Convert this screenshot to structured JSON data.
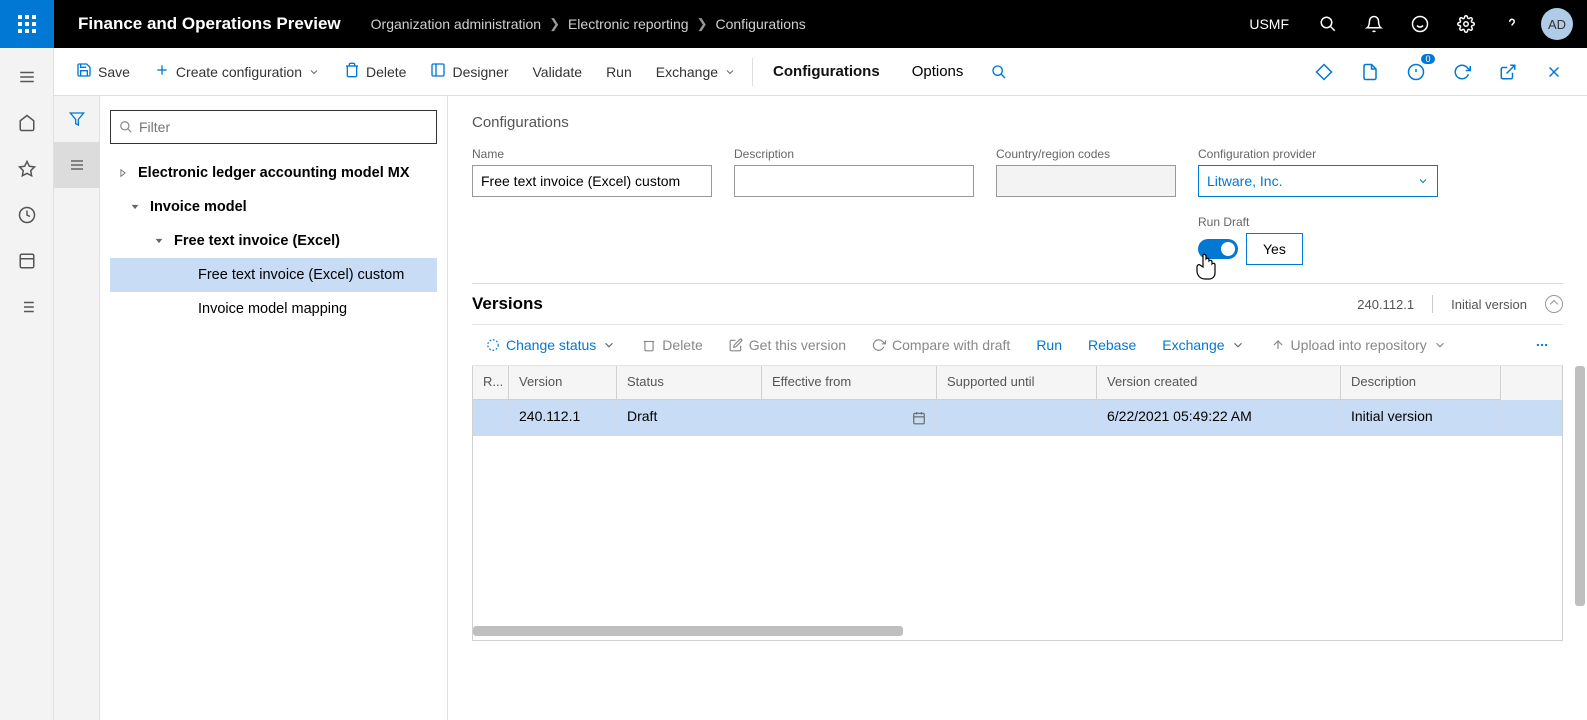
{
  "header": {
    "appTitle": "Finance and Operations Preview",
    "breadcrumbs": [
      "Organization administration",
      "Electronic reporting",
      "Configurations"
    ],
    "org": "USMF",
    "avatar": "AD",
    "badgeCount": "0"
  },
  "actions": {
    "save": "Save",
    "create": "Create configuration",
    "delete": "Delete",
    "designer": "Designer",
    "validate": "Validate",
    "run": "Run",
    "exchange": "Exchange",
    "tabConfigurations": "Configurations",
    "tabOptions": "Options"
  },
  "tree": {
    "filterPlaceholder": "Filter",
    "nodes": [
      {
        "label": "Electronic ledger accounting model MX",
        "level": 0,
        "expanded": false,
        "selected": false
      },
      {
        "label": "Invoice model",
        "level": 1,
        "expanded": true,
        "selected": false
      },
      {
        "label": "Free text invoice (Excel)",
        "level": 2,
        "expanded": true,
        "selected": false
      },
      {
        "label": "Free text invoice (Excel) custom",
        "level": 3,
        "expanded": false,
        "selected": true
      },
      {
        "label": "Invoice model mapping",
        "level": 3,
        "expanded": false,
        "selected": false
      }
    ]
  },
  "details": {
    "sectionTitle": "Configurations",
    "nameLabel": "Name",
    "nameValue": "Free text invoice (Excel) custom",
    "descLabel": "Description",
    "descValue": "",
    "countryLabel": "Country/region codes",
    "countryValue": "",
    "providerLabel": "Configuration provider",
    "providerValue": "Litware, Inc.",
    "runDraftLabel": "Run Draft",
    "runDraftValue": "Yes"
  },
  "versions": {
    "title": "Versions",
    "metaVersion": "240.112.1",
    "metaDesc": "Initial version",
    "toolbar": {
      "changeStatus": "Change status",
      "delete": "Delete",
      "getVersion": "Get this version",
      "compare": "Compare with draft",
      "run": "Run",
      "rebase": "Rebase",
      "exchange": "Exchange",
      "upload": "Upload into repository"
    },
    "columns": [
      "R...",
      "Version",
      "Status",
      "Effective from",
      "Supported until",
      "Version created",
      "Description"
    ],
    "rows": [
      {
        "r": "",
        "version": "240.112.1",
        "status": "Draft",
        "from": "",
        "until": "",
        "created": "6/22/2021 05:49:22 AM",
        "desc": "Initial version"
      }
    ]
  }
}
